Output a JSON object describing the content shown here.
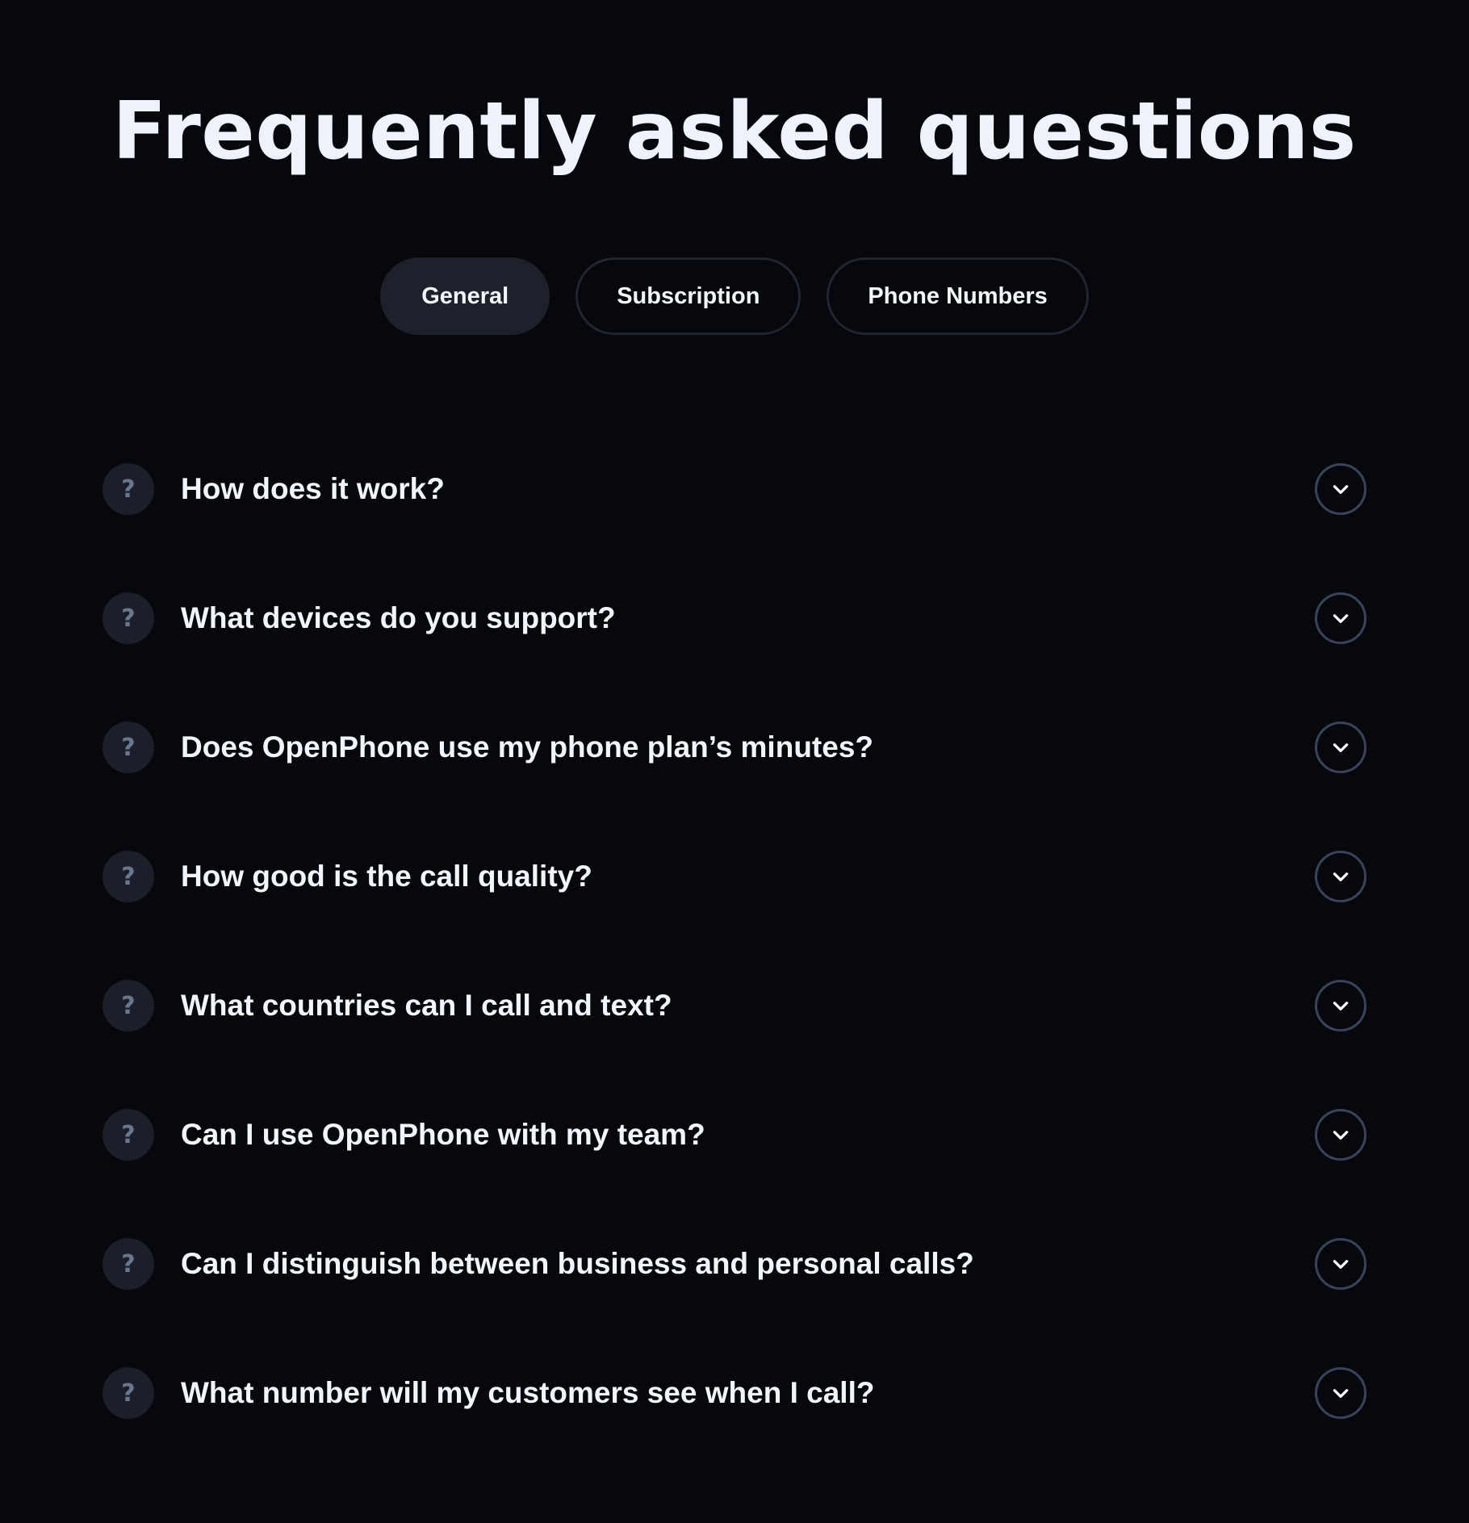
{
  "title": "Frequently asked questions",
  "tabs": [
    {
      "label": "General",
      "active": true
    },
    {
      "label": "Subscription",
      "active": false
    },
    {
      "label": "Phone Numbers",
      "active": false
    }
  ],
  "faq": {
    "question_icon_glyph": "?",
    "items": [
      {
        "question": "How does it work?"
      },
      {
        "question": "What devices do you support?"
      },
      {
        "question": "Does OpenPhone use my phone plan’s minutes?"
      },
      {
        "question": "How good is the call quality?"
      },
      {
        "question": "What countries can I call and text?"
      },
      {
        "question": "Can I use OpenPhone with my team?"
      },
      {
        "question": "Can I distinguish between business and personal calls?"
      },
      {
        "question": "What number will my customers see when I call?"
      }
    ]
  },
  "colors": {
    "background": "#07080d",
    "active_tab": "#1e212b",
    "tab_border": "#22252f",
    "question_badge": "#1c1f29",
    "question_mark": "#6b7690",
    "chevron_ring": "#39445a",
    "text": "#f1f4fa"
  },
  "icons": {
    "question": "question-mark-icon",
    "expand": "chevron-down-icon"
  }
}
